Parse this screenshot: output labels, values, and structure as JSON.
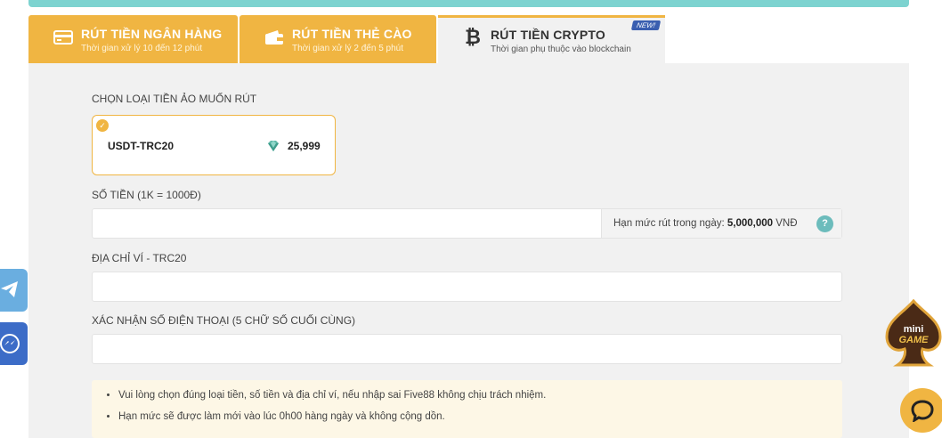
{
  "tabs": [
    {
      "title": "RÚT TIỀN NGÂN HÀNG",
      "subtitle": "Thời gian xử lý 10 đến 12 phút",
      "icon": "bank-card-icon"
    },
    {
      "title": "RÚT TIỀN THẺ CÀO",
      "subtitle": "Thời gian xử lý 2 đến 5 phút",
      "icon": "wallet-icon"
    },
    {
      "title": "RÚT TIỀN CRYPTO",
      "subtitle": "Thời gian phụ thuộc vào blockchain",
      "icon": "bitcoin-icon",
      "badge": "NEW!",
      "active": true
    }
  ],
  "form": {
    "coin_label": "CHỌN LOẠI TIỀN ẢO MUỐN RÚT",
    "coin": {
      "name": "USDT-TRC20",
      "balance": "25,999"
    },
    "amount_label": "SỐ TIỀN (1K = 1000Đ)",
    "amount_value": "",
    "limit_prefix": "Hạn mức rút trong ngày:",
    "limit_amount": "5,000,000",
    "limit_unit": "VNĐ",
    "help_symbol": "?",
    "wallet_label": "ĐỊA CHỈ VÍ - TRC20",
    "wallet_value": "",
    "phone_label": "XÁC NHẬN SỐ ĐIỆN THOẠI (5 CHỮ SỐ CUỐI CÙNG)",
    "phone_value": ""
  },
  "notes": [
    "Vui lòng chọn đúng loại tiền, số tiền và địa chỉ ví, nếu nhập sai Five88 không chịu trách nhiệm.",
    "Hạn mức sẽ được làm mới vào lúc 0h00 hàng ngày và không cộng dồn."
  ],
  "floating": {
    "minigame_text_1": "mini",
    "minigame_text_2": "GAME"
  },
  "colors": {
    "accent": "#f0b542",
    "teal": "#7dd3d0",
    "panel": "#f1f1f1"
  }
}
